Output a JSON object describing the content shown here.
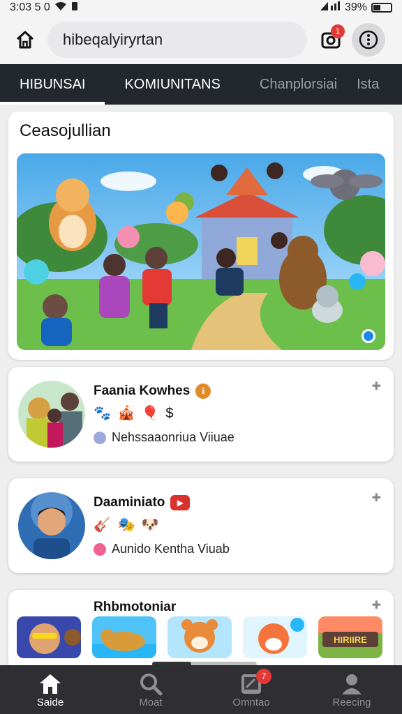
{
  "status_bar": {
    "time": "3:03 5 0",
    "battery": "39%"
  },
  "app_bar": {
    "search_text": "hibeqalyiryrtan",
    "notif_count": "1"
  },
  "tabs": [
    {
      "label": "HIBUNSAI"
    },
    {
      "label": "KOMIUNITANS"
    },
    {
      "label": "Chanplorsiai"
    },
    {
      "label": "Ista"
    }
  ],
  "hero": {
    "title": "Ceasojullian"
  },
  "cards": [
    {
      "name": "Faania Kowhes",
      "badge": "ℹ",
      "emojis": "🐾 🎪 🎈 $",
      "subtitle": "Nehssaaonriua Viiuae"
    },
    {
      "name": "Daaminiato",
      "badge": "▶",
      "emojis": "🎸 🎭 🐶",
      "subtitle": "Aunido Kentha Viuab"
    }
  ],
  "strip": {
    "title": "Rhbmotoniar",
    "thumb5_text": "HIRIIRE"
  },
  "bottom_nav": [
    {
      "label": "Saide",
      "icon": "home-icon"
    },
    {
      "label": "Moat",
      "icon": "search-icon"
    },
    {
      "label": "Omntao",
      "icon": "tablet-icon",
      "badge": "7"
    },
    {
      "label": "Reecing",
      "icon": "profile-icon"
    }
  ]
}
